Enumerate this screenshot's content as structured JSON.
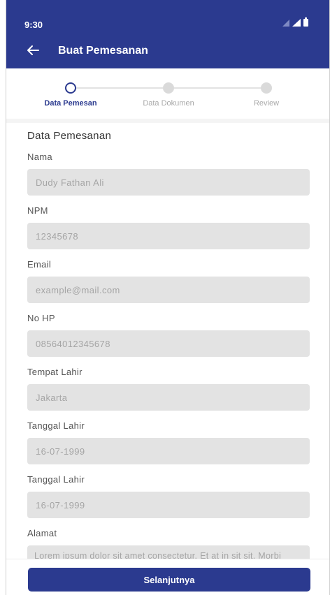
{
  "status": {
    "time": "9:30"
  },
  "appbar": {
    "title": "Buat Pemesanan",
    "color": "#2b3a8f"
  },
  "stepper": {
    "steps": [
      {
        "label": "Data Pemesan",
        "active": true
      },
      {
        "label": "Data Dokumen",
        "active": false
      },
      {
        "label": "Review",
        "active": false
      }
    ]
  },
  "form": {
    "section_title": "Data Pemesanan",
    "fields": [
      {
        "label": "Nama",
        "value": "Dudy Fathan Ali"
      },
      {
        "label": "NPM",
        "value": "12345678"
      },
      {
        "label": "Email",
        "value": "example@mail.com"
      },
      {
        "label": "No HP",
        "value": "08564012345678"
      },
      {
        "label": "Tempat Lahir",
        "value": "Jakarta"
      },
      {
        "label": "Tanggal Lahir",
        "value": "16-07-1999"
      },
      {
        "label": "Tanggal Lahir",
        "value": "16-07-1999"
      }
    ],
    "address": {
      "label": "Alamat",
      "value": "Lorem ipsum dolor sit amet consectetur. Et at in sit sit. Morbi faucibus etiam nulla eu mattis fringilla odio purus. Mauris mi sed bibendum nibh augue. Amet sed feugiat."
    }
  },
  "footer": {
    "next_label": "Selanjutnya"
  }
}
